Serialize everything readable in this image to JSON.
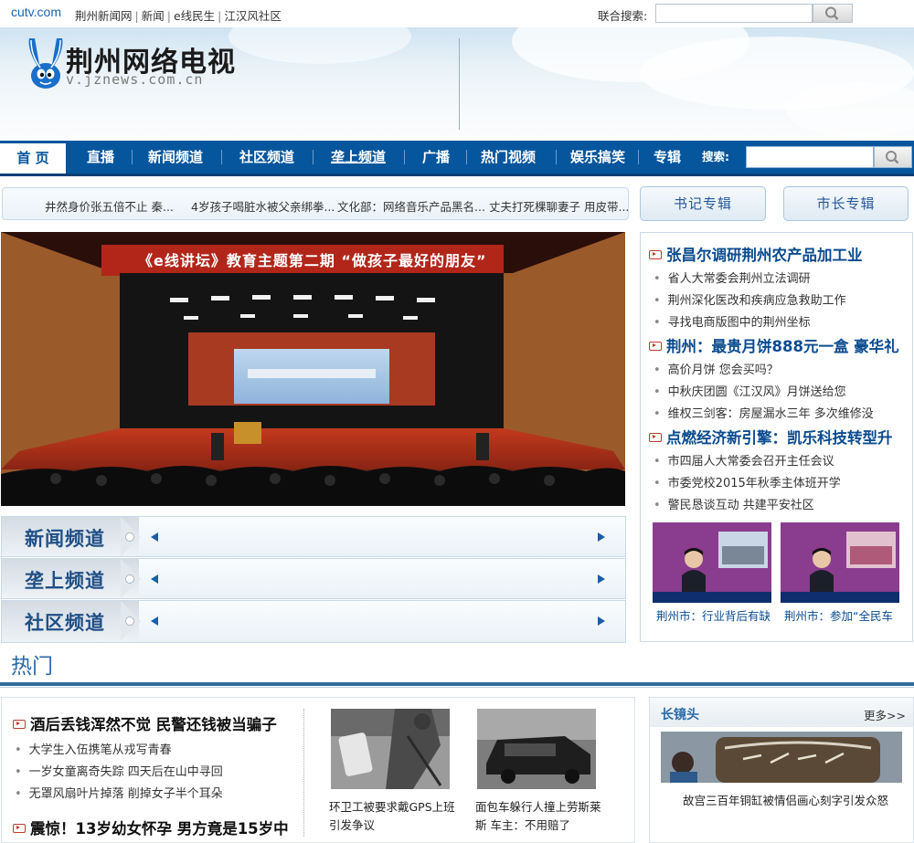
{
  "topbar": {
    "brand": "cutv.com",
    "links": [
      "荆州新闻网",
      "新闻",
      "e线民生",
      "江汉风社区"
    ],
    "separators": [
      "|",
      "|",
      "|"
    ],
    "joint_search_label": "联合搜索:"
  },
  "banner": {
    "logo_text": "荆州网络电视",
    "logo_url": "v.jznews.com.cn"
  },
  "nav": {
    "items": [
      "首 页",
      "直播",
      "新闻频道",
      "社区频道",
      "垄上频道",
      "广播",
      "热门视频",
      "娱乐搞笑",
      "专辑"
    ],
    "search_label": "搜索:"
  },
  "ticker": {
    "items": [
      "井然身价张五倍不止 秦...",
      "4岁孩子喝脏水被父亲绑拳...",
      "文化部：网络音乐产品黑名...",
      "丈夫打死棵聊妻子 用皮带..."
    ]
  },
  "specials": {
    "secretary": "书记专辑",
    "mayor": "市长专辑"
  },
  "main_picture": {
    "banner_text": "《e线讲坛》教育主题第二期 “做孩子最好的朋友”"
  },
  "channels": [
    "新闻频道",
    "垄上频道",
    "社区频道"
  ],
  "news": {
    "groups": [
      {
        "headline": "张昌尔调研荆州农产品加工业",
        "items": [
          "省人大常委会荆州立法调研",
          "荆州深化医改和疾病应急救助工作",
          "寻找电商版图中的荆州坐标"
        ]
      },
      {
        "headline": "荆州：最贵月饼888元一盒 豪华礼",
        "items": [
          "高价月饼 您会买吗？",
          "中秋庆团圆《江汉风》月饼送给您",
          "维权三剑客：房屋漏水三年 多次维修没"
        ]
      },
      {
        "headline": "点燃经济新引擎：凯乐科技转型升",
        "items": [
          "市四届人大常委会召开主任会议",
          "市委党校2015年秋季主体班开学",
          "警民恳谈互动 共建平安社区"
        ]
      }
    ],
    "videos": [
      {
        "caption": "荆州市：行业背后有缺"
      },
      {
        "caption": "荆州市：参加“全民车"
      }
    ]
  },
  "hot": {
    "title": "热门",
    "headline1": "酒后丢钱浑然不觉 民警还钱被当骗子",
    "items": [
      "大学生入伍携笔从戎写青春",
      "一岁女童离奇失踪 四天后在山中寻回",
      "无罩风扇叶片掉落 削掉女子半个耳朵"
    ],
    "headline2": "震惊！13岁幼女怀孕 男方竟是15岁中",
    "photos": [
      {
        "caption": "环卫工被要求戴GPS上班 引发争议"
      },
      {
        "caption": "面包车躲行人撞上劳斯莱斯 车主：不用赔了"
      }
    ]
  },
  "lens": {
    "title": "长镜头",
    "more": "更多>>",
    "caption": "故宫三百年铜缸被情侣画心刻字引发众怒"
  }
}
